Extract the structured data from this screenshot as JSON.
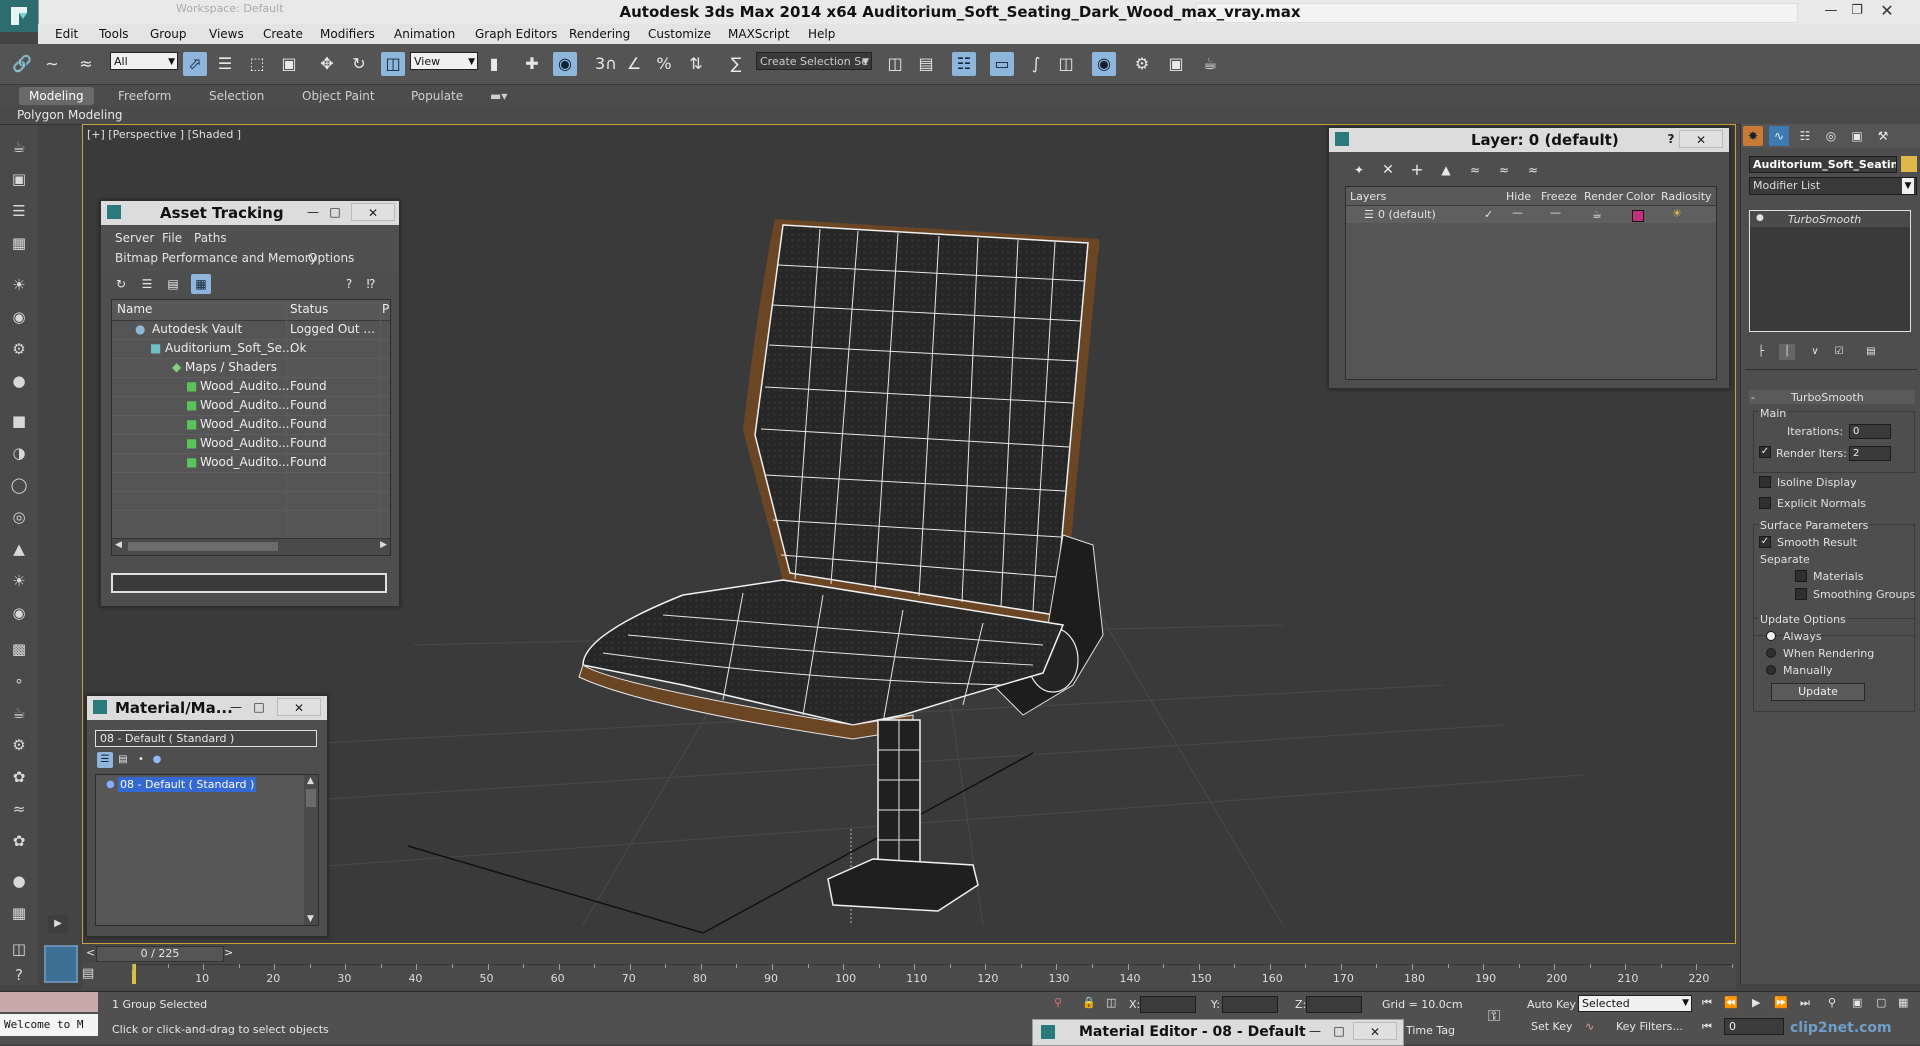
{
  "app": {
    "title": "Autodesk 3ds Max  2014 x64      Auditorium_Soft_Seating_Dark_Wood_max_vray.max",
    "workspace": "Workspace: Default"
  },
  "menu": [
    "Edit",
    "Tools",
    "Group",
    "Views",
    "Create",
    "Modifiers",
    "Animation",
    "Graph Editors",
    "Rendering",
    "Customize",
    "MAXScript",
    "Help"
  ],
  "toolbar": {
    "selection_filter": "All",
    "ref_coord": "View",
    "named_selection": "Create Selection Se"
  },
  "ribbon": {
    "tabs": [
      "Modeling",
      "Freeform",
      "Selection",
      "Object Paint",
      "Populate"
    ],
    "panel_label": "Polygon Modeling"
  },
  "viewport": {
    "label": "[+] [Perspective ] [Shaded ]"
  },
  "asset_tracking": {
    "title": "Asset Tracking",
    "menus": [
      "Server",
      "File",
      "Paths"
    ],
    "menus2": [
      "Bitmap Performance and Memory",
      "Options"
    ],
    "columns": [
      "Name",
      "Status",
      "P"
    ],
    "rows": [
      {
        "name": "Autodesk Vault",
        "status": "Logged Out ..."
      },
      {
        "name": "Auditorium_Soft_Se...",
        "status": "Ok"
      },
      {
        "name": "Maps / Shaders",
        "status": ""
      },
      {
        "name": "Wood_Audito...",
        "status": "Found"
      },
      {
        "name": "Wood_Audito...",
        "status": "Found"
      },
      {
        "name": "Wood_Audito...",
        "status": "Found"
      },
      {
        "name": "Wood_Audito...",
        "status": "Found"
      },
      {
        "name": "Wood_Audito...",
        "status": "Found"
      }
    ]
  },
  "material_map": {
    "title": "Material/Ma...",
    "field": "08 - Default  ( Standard )",
    "item": "08 - Default  ( Standard )"
  },
  "layer": {
    "title": "Layer: 0 (default)",
    "help": "?",
    "columns": [
      "Layers",
      "Hide",
      "Freeze",
      "Render",
      "Color",
      "Radiosity"
    ],
    "row": "0 (default)",
    "color": "#c0307e"
  },
  "command_panel": {
    "object_name": "Auditorium_Soft_Seating",
    "modifier_list": "Modifier List",
    "stack_item": "TurboSmooth",
    "rollout_title": "TurboSmooth",
    "main": "Main",
    "iterations_label": "Iterations:",
    "iterations": "0",
    "render_iters_label": "Render Iters:",
    "render_iters": "2",
    "isoline": "Isoline Display",
    "explicit_normals": "Explicit Normals",
    "surface_params": "Surface Parameters",
    "smooth_result": "Smooth Result",
    "separate": "Separate",
    "materials": "Materials",
    "smoothing_groups": "Smoothing Groups",
    "update_options": "Update Options",
    "always": "Always",
    "when_rendering": "When Rendering",
    "manually": "Manually",
    "update_button": "Update",
    "render_iters_checked": true,
    "smooth_result_checked": true,
    "update_mode": "Always"
  },
  "timeline": {
    "frame_counter": "0 / 225",
    "ticks": [
      "10",
      "20",
      "30",
      "40",
      "50",
      "60",
      "70",
      "80",
      "90",
      "100",
      "110",
      "120",
      "130",
      "140",
      "150",
      "160",
      "170",
      "180",
      "190",
      "200",
      "210",
      "220"
    ]
  },
  "status": {
    "selection": "1 Group Selected",
    "prompt": "Click or click-and-drag to select objects",
    "listener": "Welcome to M",
    "x_label": "X:",
    "y_label": "Y:",
    "z_label": "Z:",
    "grid": "Grid = 10.0cm",
    "auto_key": "Auto Key",
    "set_key": "Set Key",
    "key_mode": "Selected",
    "key_filters": "Key Filters...",
    "time_tag": "Time Tag",
    "frame": "0",
    "material_editor": "Material Editor - 08 - Default",
    "watermark": "clip2net.com"
  }
}
